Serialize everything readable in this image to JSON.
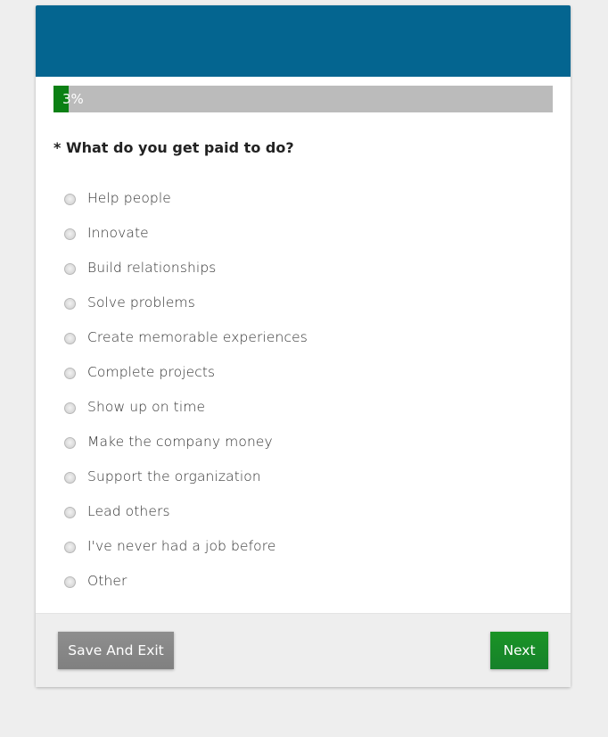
{
  "colors": {
    "header": "#046590",
    "progress_fill": "#0b8014",
    "progress_track": "#bbbbbb",
    "save_button": "#868686",
    "next_button": "#188b28"
  },
  "progress": {
    "value_percent": 3,
    "label": "3%"
  },
  "question": {
    "text": "* What do you get paid to do?",
    "required": true
  },
  "options": [
    {
      "label": "Help people",
      "selected": false
    },
    {
      "label": "Innovate",
      "selected": false
    },
    {
      "label": "Build relationships",
      "selected": false
    },
    {
      "label": "Solve problems",
      "selected": false
    },
    {
      "label": "Create memorable experiences",
      "selected": false
    },
    {
      "label": "Complete projects",
      "selected": false
    },
    {
      "label": "Show up on time",
      "selected": false
    },
    {
      "label": "Make the company money",
      "selected": false
    },
    {
      "label": "Support the organization",
      "selected": false
    },
    {
      "label": "Lead others",
      "selected": false
    },
    {
      "label": "I've never had a job before",
      "selected": false
    },
    {
      "label": "Other",
      "selected": false
    }
  ],
  "footer": {
    "save_label": "Save And Exit",
    "next_label": "Next"
  }
}
